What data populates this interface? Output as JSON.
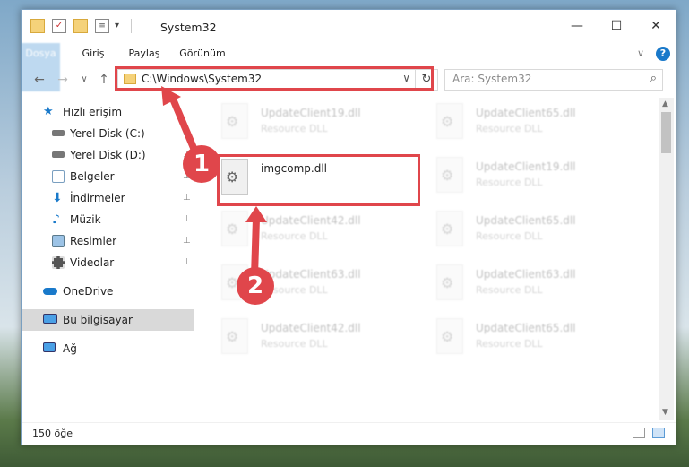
{
  "window": {
    "title": "System32",
    "controls": {
      "minimize": "—",
      "maximize": "☐",
      "close": "✕"
    }
  },
  "ribbon": {
    "tabs": [
      "Dosya",
      "Giriş",
      "Paylaş",
      "Görünüm"
    ],
    "help": "?",
    "collapse": "∨"
  },
  "navigation": {
    "back": "←",
    "forward": "→",
    "recent": "∨",
    "up": "↑"
  },
  "address": {
    "path": "C:\\Windows\\System32",
    "dropdown": "∨",
    "refresh": "↻"
  },
  "search": {
    "placeholder": "Ara: System32",
    "icon": "⌕"
  },
  "sidebar": {
    "items": [
      {
        "label": "Hızlı erişim",
        "icon": "star-icon",
        "pinned": false
      },
      {
        "label": "Yerel Disk (C:)",
        "icon": "drive-icon",
        "pinned": true
      },
      {
        "label": "Yerel Disk (D:)",
        "icon": "drive-icon",
        "pinned": true
      },
      {
        "label": "Belgeler",
        "icon": "documents-icon",
        "pinned": true
      },
      {
        "label": "İndirmeler",
        "icon": "download-icon",
        "pinned": true
      },
      {
        "label": "Müzik",
        "icon": "music-icon",
        "pinned": true
      },
      {
        "label": "Resimler",
        "icon": "pictures-icon",
        "pinned": true
      },
      {
        "label": "Videolar",
        "icon": "videos-icon",
        "pinned": true
      },
      {
        "label": "OneDrive",
        "icon": "cloud-icon",
        "pinned": false
      },
      {
        "label": "Bu bilgisayar",
        "icon": "computer-icon",
        "pinned": false
      },
      {
        "label": "Ağ",
        "icon": "network-icon",
        "pinned": false
      }
    ],
    "pin_glyph": "📌"
  },
  "files": {
    "left": [
      {
        "name": "UpdateClient19.dll",
        "type": "Resource DLL"
      },
      {
        "name": "imgcomp.dll",
        "type": ""
      },
      {
        "name": "UpdateClient42.dll",
        "type": "Resource DLL"
      },
      {
        "name": "UpdateClient63.dll",
        "type": "Resource DLL"
      },
      {
        "name": "UpdateClient42.dll",
        "type": "Resource DLL"
      }
    ],
    "right": [
      {
        "name": "UpdateClient65.dll",
        "type": "Resource DLL"
      },
      {
        "name": "UpdateClient19.dll",
        "type": "Resource DLL"
      },
      {
        "name": "UpdateClient65.dll",
        "type": "Resource DLL"
      },
      {
        "name": "UpdateClient63.dll",
        "type": "Resource DLL"
      },
      {
        "name": "UpdateClient65.dll",
        "type": "Resource DLL"
      }
    ]
  },
  "status": {
    "count": "150 öğe"
  },
  "annotations": {
    "step1": "1",
    "step2": "2",
    "color": "#e0464b"
  }
}
